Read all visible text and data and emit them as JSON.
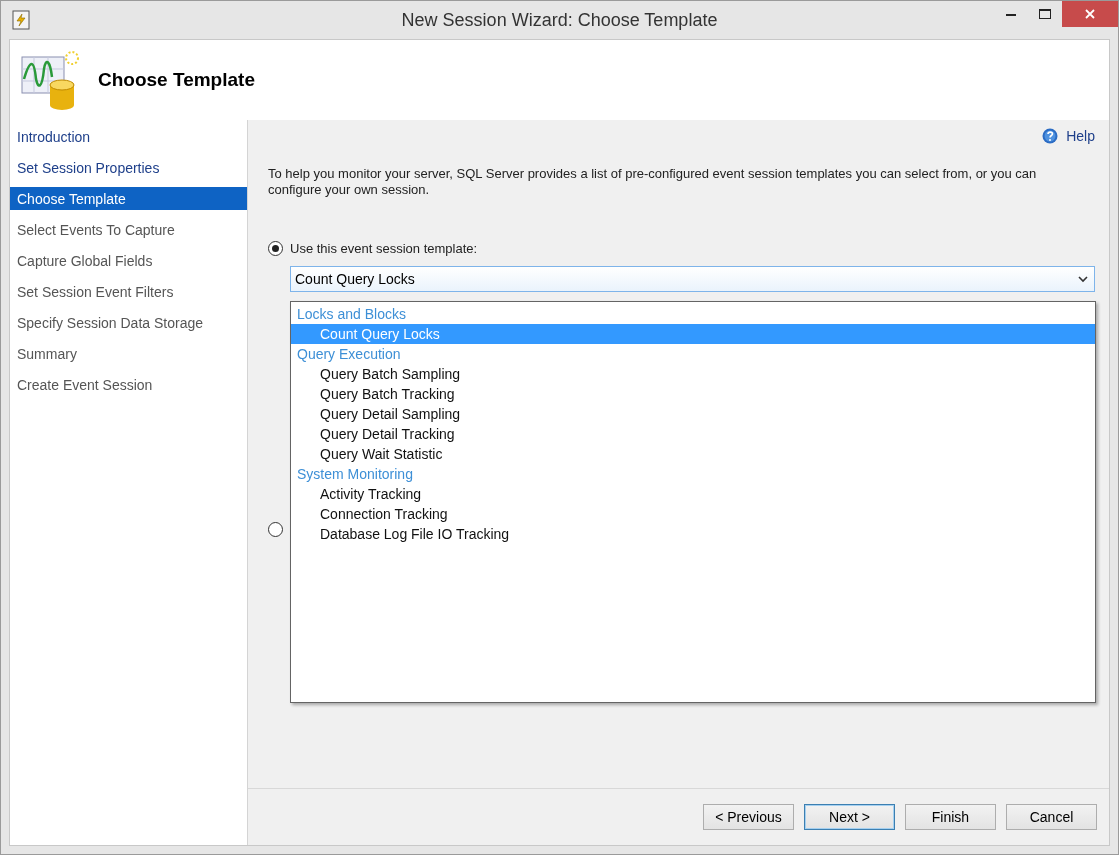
{
  "window": {
    "title": "New Session Wizard: Choose Template"
  },
  "header": {
    "title": "Choose Template"
  },
  "sidebar": {
    "items": [
      {
        "label": "Introduction",
        "selected": false,
        "visited": true
      },
      {
        "label": "Set Session Properties",
        "selected": false,
        "visited": true
      },
      {
        "label": "Choose Template",
        "selected": true,
        "visited": true
      },
      {
        "label": "Select Events To Capture",
        "selected": false,
        "visited": false
      },
      {
        "label": "Capture Global Fields",
        "selected": false,
        "visited": false
      },
      {
        "label": "Set Session Event Filters",
        "selected": false,
        "visited": false
      },
      {
        "label": "Specify Session Data Storage",
        "selected": false,
        "visited": false
      },
      {
        "label": "Summary",
        "selected": false,
        "visited": false
      },
      {
        "label": "Create Event Session",
        "selected": false,
        "visited": false
      }
    ]
  },
  "help": {
    "label": "Help"
  },
  "description": "To help you monitor your server, SQL Server provides a list of pre-configured event session templates you can select from, or you can configure your own session.",
  "options": [
    {
      "label": "Use this event session template:",
      "selected": true
    },
    {
      "selected": false
    }
  ],
  "template_dropdown": {
    "value": "Count Query Locks",
    "expanded": true,
    "items": [
      {
        "kind": "group",
        "label": "Locks and Blocks",
        "selected": false
      },
      {
        "kind": "item",
        "label": "Count Query Locks",
        "selected": true
      },
      {
        "kind": "group",
        "label": "Query Execution",
        "selected": false
      },
      {
        "kind": "item",
        "label": "Query Batch Sampling",
        "selected": false
      },
      {
        "kind": "item",
        "label": "Query Batch Tracking",
        "selected": false
      },
      {
        "kind": "item",
        "label": "Query Detail Sampling",
        "selected": false
      },
      {
        "kind": "item",
        "label": "Query Detail Tracking",
        "selected": false
      },
      {
        "kind": "item",
        "label": "Query Wait Statistic",
        "selected": false
      },
      {
        "kind": "group",
        "label": "System Monitoring",
        "selected": false
      },
      {
        "kind": "item",
        "label": "Activity Tracking",
        "selected": false
      },
      {
        "kind": "item",
        "label": "Connection Tracking",
        "selected": false
      },
      {
        "kind": "item",
        "label": "Database Log File IO Tracking",
        "selected": false
      }
    ]
  },
  "buttons": [
    {
      "label": "< Previous",
      "default": false
    },
    {
      "label": "Next >",
      "default": true
    },
    {
      "label": "Finish",
      "default": false
    },
    {
      "label": "Cancel",
      "default": false
    }
  ]
}
